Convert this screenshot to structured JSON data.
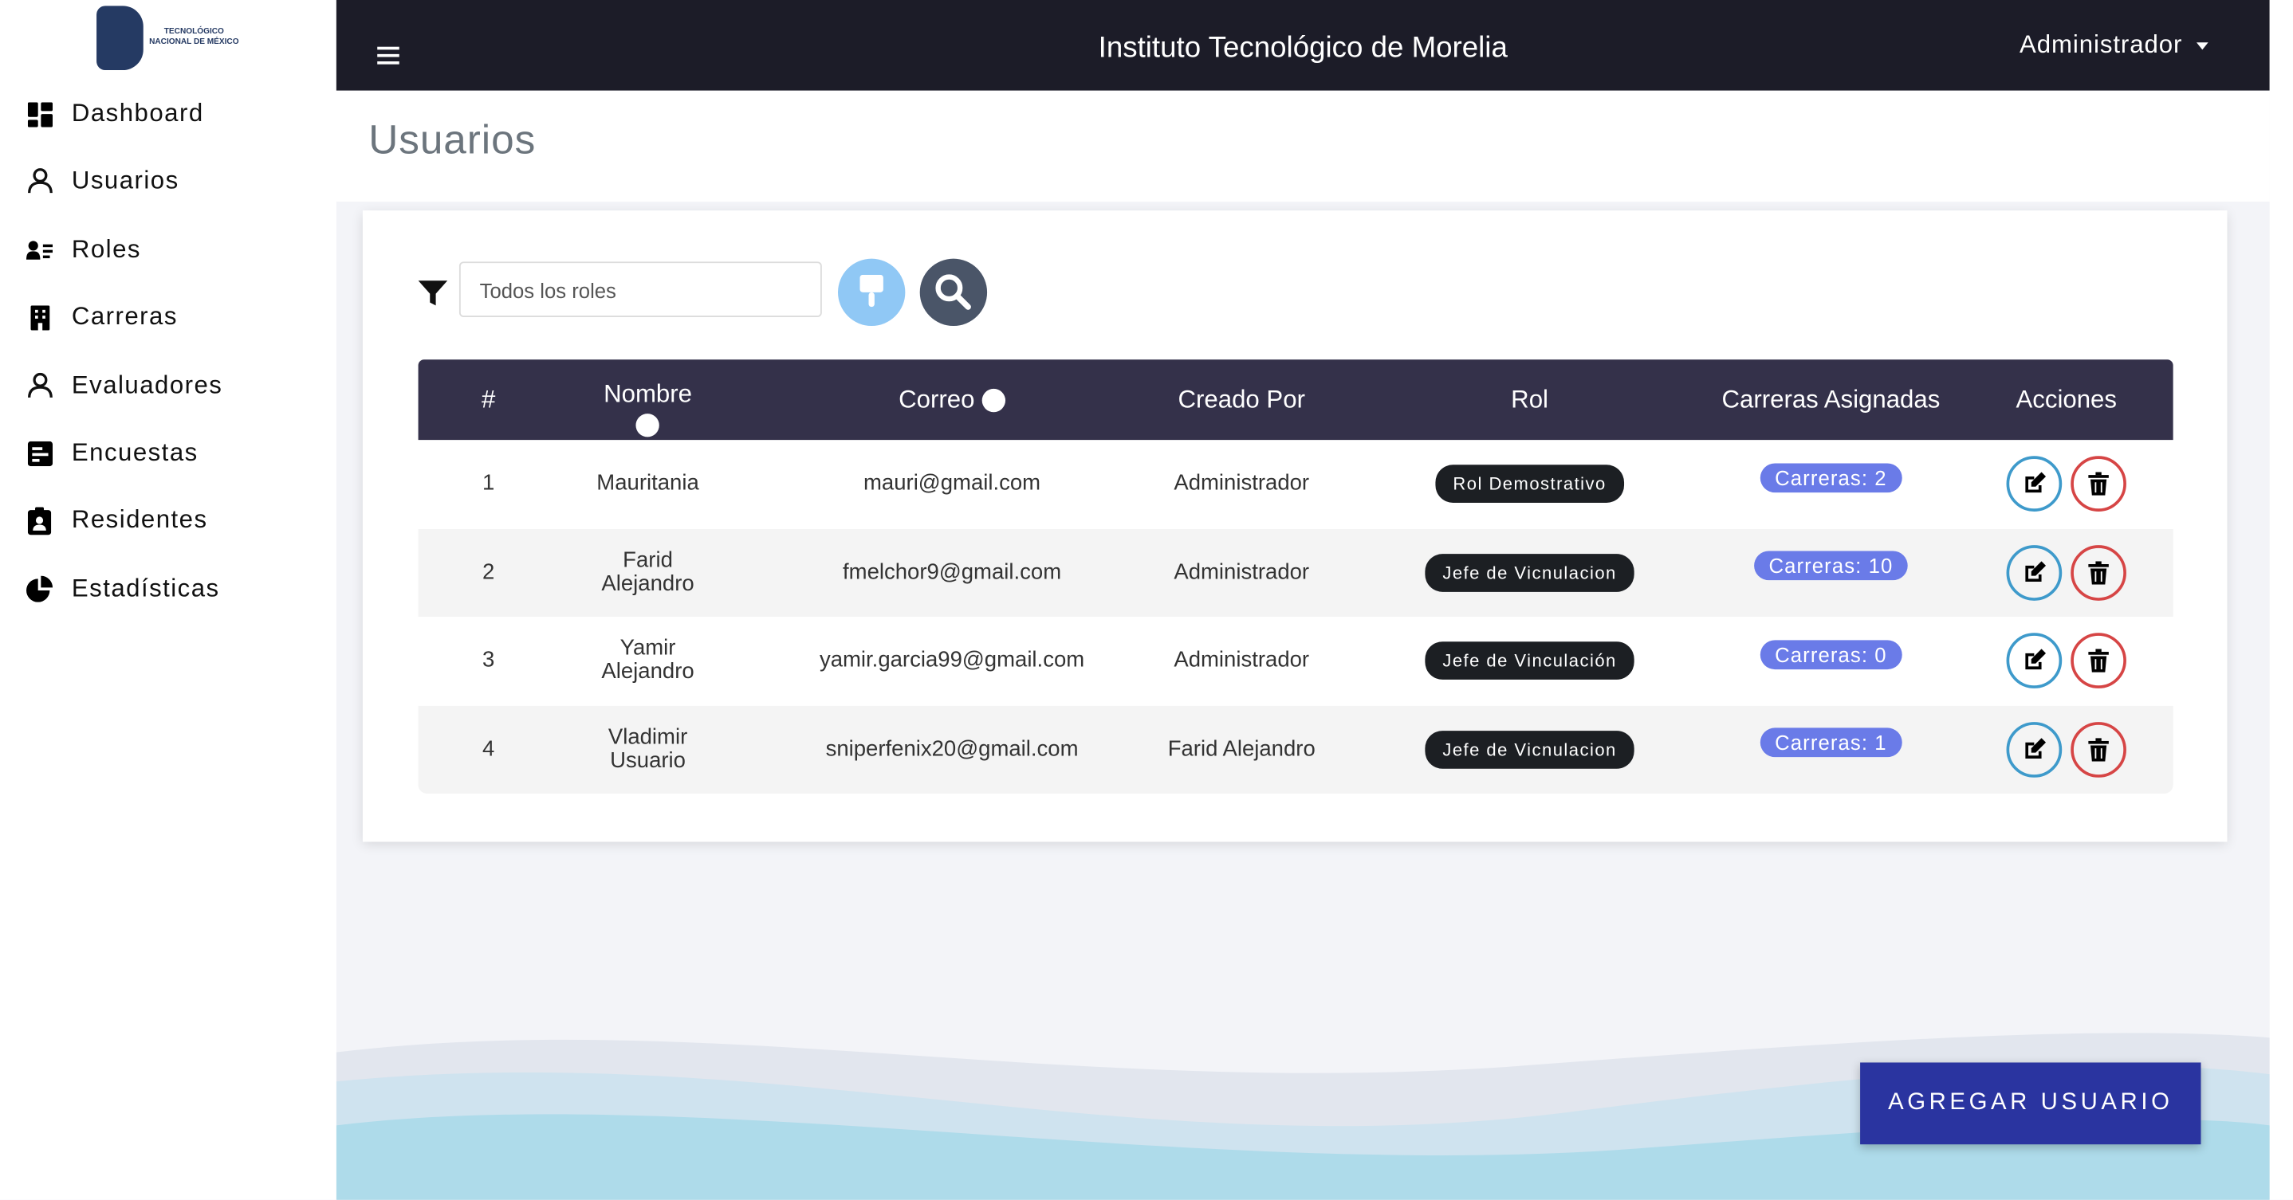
{
  "logo": {
    "line1": "TECNOLÓGICO",
    "line2": "NACIONAL DE MÉXICO"
  },
  "sidebar": {
    "items": [
      {
        "label": "Dashboard",
        "icon": "dashboard-icon"
      },
      {
        "label": "Usuarios",
        "icon": "user-icon"
      },
      {
        "label": "Roles",
        "icon": "user-list-icon"
      },
      {
        "label": "Carreras",
        "icon": "building-icon"
      },
      {
        "label": "Evaluadores",
        "icon": "user-icon"
      },
      {
        "label": "Encuestas",
        "icon": "poll-icon"
      },
      {
        "label": "Residentes",
        "icon": "clipboard-user-icon"
      },
      {
        "label": "Estadísticas",
        "icon": "pie-chart-icon"
      }
    ]
  },
  "topbar": {
    "title": "Instituto Tecnológico de Morelia",
    "user": "Administrador"
  },
  "page": {
    "title": "Usuarios"
  },
  "filter": {
    "placeholder": "Todos los roles"
  },
  "table": {
    "headers": [
      "#",
      "Nombre",
      "Correo",
      "Creado Por",
      "Rol",
      "Carreras Asignadas",
      "Acciones"
    ],
    "rows": [
      {
        "num": "1",
        "name": "Mauritania",
        "email": "mauri@gmail.com",
        "created_by": "Administrador",
        "role": "Rol Demostrativo",
        "careers": "Carreras: 2"
      },
      {
        "num": "2",
        "name": "Farid\nAlejandro",
        "email": "fmelchor9@gmail.com",
        "created_by": "Administrador",
        "role": "Jefe de Vicnulacion",
        "careers": "Carreras: 10"
      },
      {
        "num": "3",
        "name": "Yamir\nAlejandro",
        "email": "yamir.garcia99@gmail.com",
        "created_by": "Administrador",
        "role": "Jefe de Vinculación",
        "careers": "Carreras: 0"
      },
      {
        "num": "4",
        "name": "Vladimir\nUsuario",
        "email": "sniperfenix20@gmail.com",
        "created_by": "Farid Alejandro",
        "role": "Jefe de Vicnulacion",
        "careers": "Carreras: 1"
      }
    ]
  },
  "add_button": "AGREGAR USUARIO",
  "colors": {
    "topbar": "#1c1c28",
    "table_header": "#34314a",
    "badge": "#6a7be8",
    "add": "#2a34a0",
    "edit": "#3e9acb",
    "delete": "#d64545"
  }
}
